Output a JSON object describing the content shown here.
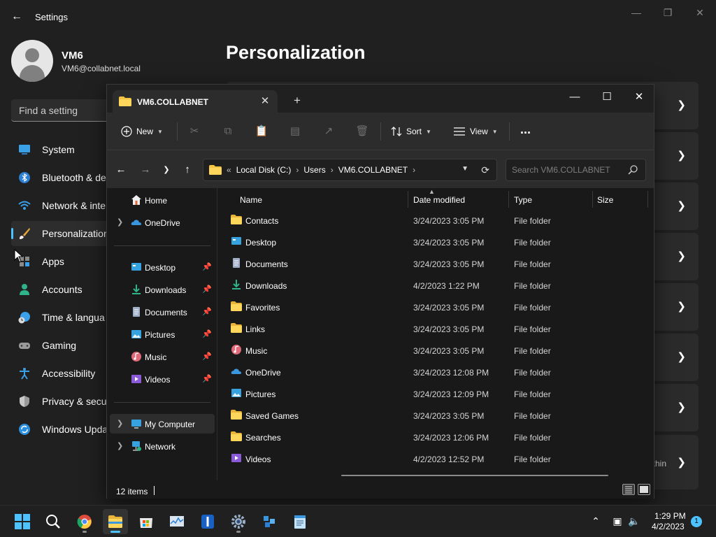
{
  "settings": {
    "title": "Settings",
    "user": {
      "name": "VM6",
      "email": "VM6@collabnet.local"
    },
    "search_placeholder": "Find a setting",
    "page_title": "Personalization",
    "nav": [
      {
        "label": "System",
        "icon": "system-icon"
      },
      {
        "label": "Bluetooth & de",
        "icon": "bluetooth-icon"
      },
      {
        "label": "Network & inte",
        "icon": "network-icon"
      },
      {
        "label": "Personalization",
        "icon": "personalization-brush-icon",
        "selected": true
      },
      {
        "label": "Apps",
        "icon": "apps-icon"
      },
      {
        "label": "Accounts",
        "icon": "accounts-icon"
      },
      {
        "label": "Time & langua",
        "icon": "time-language-icon"
      },
      {
        "label": "Gaming",
        "icon": "gaming-icon"
      },
      {
        "label": "Accessibility",
        "icon": "accessibility-icon"
      },
      {
        "label": "Privacy & secu",
        "icon": "privacy-shield-icon"
      },
      {
        "label": "Windows Upda",
        "icon": "windows-update-icon"
      }
    ],
    "partial_card_text": "thin"
  },
  "explorer": {
    "tab_title": "VM6.COLLABNET",
    "toolbar": {
      "new_label": "New",
      "sort_label": "Sort",
      "view_label": "View",
      "more_label": "..."
    },
    "breadcrumbs": [
      "Local Disk (C:)",
      "Users",
      "VM6.COLLABNET"
    ],
    "search_placeholder": "Search VM6.COLLABNET",
    "nav_pane": {
      "home": "Home",
      "onedrive": "OneDrive",
      "quick_access": [
        "Desktop",
        "Downloads",
        "Documents",
        "Pictures",
        "Music",
        "Videos"
      ],
      "my_computer": "My Computer",
      "network": "Network"
    },
    "columns": {
      "name": "Name",
      "date": "Date modified",
      "type": "Type",
      "size": "Size"
    },
    "files": [
      {
        "name": "Contacts",
        "date": "3/24/2023 3:05 PM",
        "type": "File folder",
        "icon": "folder-icon"
      },
      {
        "name": "Desktop",
        "date": "3/24/2023 3:05 PM",
        "type": "File folder",
        "icon": "desktop-folder-icon"
      },
      {
        "name": "Documents",
        "date": "3/24/2023 3:05 PM",
        "type": "File folder",
        "icon": "documents-folder-icon"
      },
      {
        "name": "Downloads",
        "date": "4/2/2023 1:22 PM",
        "type": "File folder",
        "icon": "downloads-folder-icon"
      },
      {
        "name": "Favorites",
        "date": "3/24/2023 3:05 PM",
        "type": "File folder",
        "icon": "folder-icon"
      },
      {
        "name": "Links",
        "date": "3/24/2023 3:05 PM",
        "type": "File folder",
        "icon": "folder-icon"
      },
      {
        "name": "Music",
        "date": "3/24/2023 3:05 PM",
        "type": "File folder",
        "icon": "music-folder-icon"
      },
      {
        "name": "OneDrive",
        "date": "3/24/2023 12:08 PM",
        "type": "File folder",
        "icon": "onedrive-cloud-icon"
      },
      {
        "name": "Pictures",
        "date": "3/24/2023 12:09 PM",
        "type": "File folder",
        "icon": "pictures-folder-icon"
      },
      {
        "name": "Saved Games",
        "date": "3/24/2023 3:05 PM",
        "type": "File folder",
        "icon": "folder-icon"
      },
      {
        "name": "Searches",
        "date": "3/24/2023 12:06 PM",
        "type": "File folder",
        "icon": "folder-icon"
      },
      {
        "name": "Videos",
        "date": "4/2/2023 12:52 PM",
        "type": "File folder",
        "icon": "videos-folder-icon"
      }
    ],
    "status": {
      "item_count": "12 items"
    }
  },
  "taskbar": {
    "time": "1:29 PM",
    "date": "4/2/2023",
    "notification_count": "1"
  },
  "colors": {
    "accent": "#4cc2ff",
    "folder": "#f4c542",
    "window_bg": "#191919"
  }
}
